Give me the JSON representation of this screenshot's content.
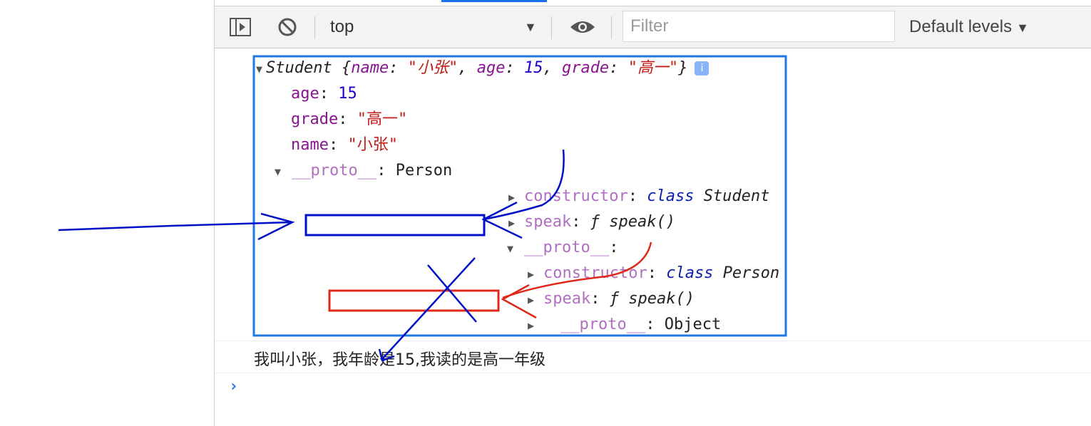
{
  "toolbar": {
    "context_label": "top",
    "context_arrow": "▼",
    "filter_placeholder": "Filter",
    "levels_label": "Default levels",
    "levels_arrow": "▼"
  },
  "object_tree": {
    "summary_class": "Student",
    "summary_name_key": "name",
    "summary_name_val": "\"小张\"",
    "summary_age_key": "age",
    "summary_age_val": "15",
    "summary_grade_key": "grade",
    "summary_grade_val": "\"高一\"",
    "info_badge": "i",
    "age_key": "age",
    "age_val": "15",
    "grade_key": "grade",
    "grade_val": "\"高一\"",
    "name_key": "name",
    "name_val": "\"小张\"",
    "proto1_key": "__proto__",
    "proto1_val": "Person",
    "ctor1_key": "constructor",
    "ctor1_kw": "class",
    "ctor1_name": "Student",
    "speak1_key": "speak",
    "speak1_val": "ƒ speak()",
    "proto2_key": "__proto__",
    "ctor2_key": "constructor",
    "ctor2_kw": "class",
    "ctor2_name": "Person",
    "speak2_key": "speak",
    "speak2_val": "ƒ speak()",
    "proto3_key": "__proto__",
    "proto3_val": "Object"
  },
  "console_message": "我叫小张，我年龄是15,我读的是高一年级",
  "prompt_symbol": "›",
  "colors": {
    "annotation_blue": "#1f77e6",
    "annotation_dark_blue": "#0010c8",
    "annotation_red": "#e0281a"
  }
}
